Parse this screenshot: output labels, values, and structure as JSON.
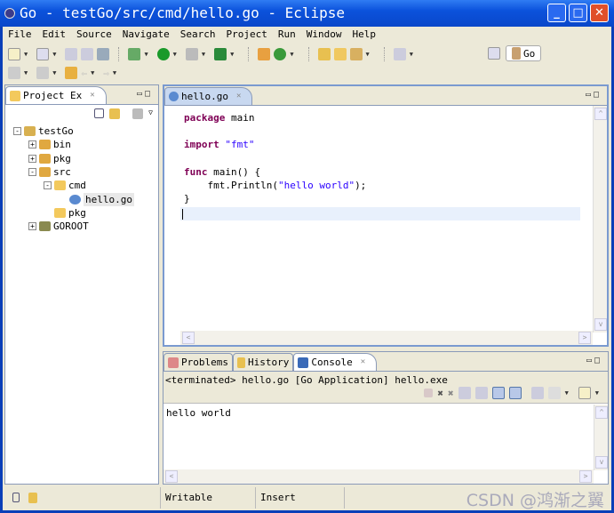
{
  "window": {
    "title": "Go - testGo/src/cmd/hello.go - Eclipse",
    "buttons": [
      "minimize",
      "maximize",
      "close"
    ]
  },
  "menu": [
    {
      "k": "F",
      "r": "ile"
    },
    {
      "k": "E",
      "r": "dit"
    },
    {
      "k": "S",
      "r": "ource"
    },
    {
      "k": "N",
      "r": "avigate"
    },
    {
      "k": "Se",
      "r": "arch",
      "alt": true
    },
    {
      "k": "P",
      "r": "roject"
    },
    {
      "k": "R",
      "r": "un"
    },
    {
      "k": "W",
      "r": "indow"
    },
    {
      "k": "H",
      "r": "elp"
    }
  ],
  "menu_labels": [
    "File",
    "Edit",
    "Source",
    "Navigate",
    "Search",
    "Project",
    "Run",
    "Window",
    "Help"
  ],
  "perspective": {
    "label": "Go"
  },
  "explorer": {
    "tab": "Project Ex",
    "tree": [
      {
        "label": "testGo",
        "depth": 0,
        "exp": "-",
        "icon": "project-icon"
      },
      {
        "label": "bin",
        "depth": 1,
        "exp": "+",
        "icon": "package-folder-icon"
      },
      {
        "label": "pkg",
        "depth": 1,
        "exp": "+",
        "icon": "package-folder-icon"
      },
      {
        "label": "src",
        "depth": 1,
        "exp": "-",
        "icon": "package-folder-icon"
      },
      {
        "label": "cmd",
        "depth": 2,
        "exp": "-",
        "icon": "folder-icon"
      },
      {
        "label": "hello.go",
        "depth": 3,
        "exp": "",
        "icon": "go-file-icon",
        "selected": true
      },
      {
        "label": "pkg",
        "depth": 2,
        "exp": "",
        "icon": "folder-icon"
      },
      {
        "label": "GOROOT",
        "depth": 1,
        "exp": "+",
        "icon": "library-icon"
      }
    ]
  },
  "editor": {
    "tab": "hello.go",
    "lines": [
      [
        {
          "t": "package",
          "c": "kw"
        },
        {
          "t": " main"
        }
      ],
      [],
      [
        {
          "t": "import",
          "c": "kw"
        },
        {
          "t": " "
        },
        {
          "t": "\"fmt\"",
          "c": "str"
        }
      ],
      [],
      [
        {
          "t": "func",
          "c": "kw"
        },
        {
          "t": " main() {"
        }
      ],
      [
        {
          "t": "    fmt.Println("
        },
        {
          "t": "\"hello world\"",
          "c": "str"
        },
        {
          "t": ");"
        }
      ],
      [
        {
          "t": "}"
        }
      ],
      []
    ]
  },
  "console": {
    "tabs": [
      "Problems",
      "History",
      "Console"
    ],
    "active": "Console",
    "header": "<terminated> hello.go [Go Application] hello.exe",
    "output": "hello world"
  },
  "status": {
    "writable": "Writable",
    "insert": "Insert"
  },
  "watermark": "CSDN @鸿渐之翼",
  "colors": {
    "titlebar": "#0b52dc",
    "keyword": "#7f0055",
    "string": "#2a00ff",
    "chrome": "#ece9d8"
  }
}
